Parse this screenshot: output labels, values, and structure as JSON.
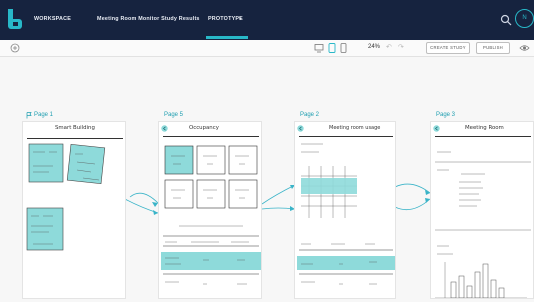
{
  "topbar": {
    "workspace": "WORKSPACE",
    "project": "Meeting Room Monitor Study Results",
    "prototype_tab": "PROTOTYPE",
    "avatar_initial": "N"
  },
  "toolbar": {
    "zoom": "24%",
    "create_study": "CREATE STUDY",
    "publish": "PUBLISH"
  },
  "pages": [
    {
      "label": "Page 1",
      "title": "Smart Building"
    },
    {
      "label": "Page 5",
      "title": "Occupancy"
    },
    {
      "label": "Page 2",
      "title": "Meeting room usage"
    },
    {
      "label": "Page 3",
      "title": "Meeting Room"
    }
  ],
  "colors": {
    "topbar": "#16233f",
    "accent": "#28b8c8",
    "highlight": "#7fd8d8"
  }
}
